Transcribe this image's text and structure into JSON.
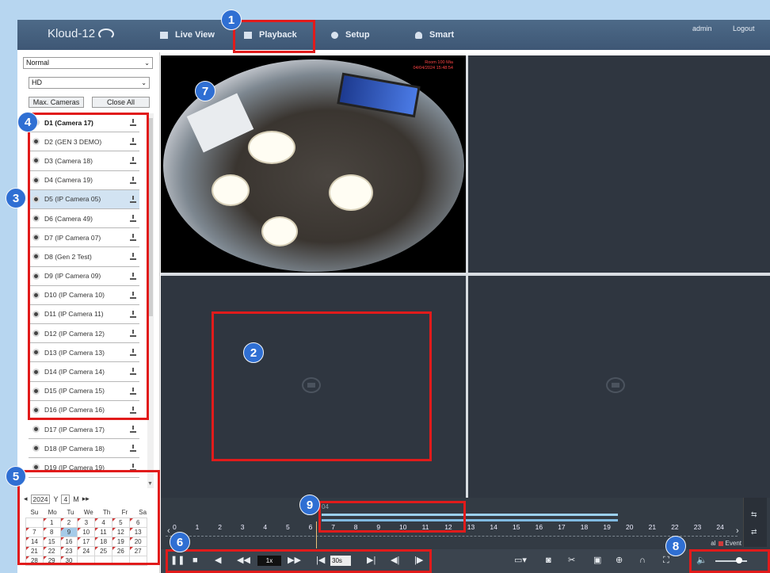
{
  "header": {
    "logo": "Kloud-12",
    "nav": [
      {
        "label": "Live View",
        "icon": "monitor-icon"
      },
      {
        "label": "Playback",
        "icon": "playback-icon"
      },
      {
        "label": "Setup",
        "icon": "gear-icon"
      },
      {
        "label": "Smart",
        "icon": "person-icon"
      }
    ],
    "user": "admin",
    "logout": "Logout"
  },
  "sidebar": {
    "mode_select": "Normal",
    "quality_select": "HD",
    "max_cameras": "Max. Cameras",
    "close_all": "Close All",
    "cameras": [
      "D1 (Camera 17)",
      "D2 (GEN 3 DEMO)",
      "D3 (Camera 18)",
      "D4 (Camera 19)",
      "D5 (IP Camera 05)",
      "D6 (Camera 49)",
      "D7 (IP Camera 07)",
      "D8 (Gen 2 Test)",
      "D9 (IP Camera 09)",
      "D10 (IP Camera 10)",
      "D11 (IP Camera 11)",
      "D12 (IP Camera 12)",
      "D13 (IP Camera 13)",
      "D14 (IP Camera 14)",
      "D15 (IP Camera 15)",
      "D16 (IP Camera 16)",
      "D17 (IP Camera 17)",
      "D18 (IP Camera 18)",
      "D19 (IP Camera 19)"
    ]
  },
  "calendar": {
    "year": "2024",
    "year_label": "Y",
    "month": "4",
    "month_label": "M",
    "weekdays": [
      "Su",
      "Mo",
      "Tu",
      "We",
      "Th",
      "Fr",
      "Sa"
    ],
    "weeks": [
      [
        "",
        "1",
        "2",
        "3",
        "4",
        "5",
        "6"
      ],
      [
        "7",
        "8",
        "9",
        "10",
        "11",
        "12",
        "13"
      ],
      [
        "14",
        "15",
        "16",
        "17",
        "18",
        "19",
        "20"
      ],
      [
        "21",
        "22",
        "23",
        "24",
        "25",
        "26",
        "27"
      ],
      [
        "28",
        "29",
        "30",
        "",
        "",
        "",
        ""
      ]
    ],
    "today": "9"
  },
  "video": {
    "osd_line1": "Room 100 Mia",
    "osd_line2": "04/04/2024 15:48:54"
  },
  "timeline": {
    "date_label": "04",
    "hours": [
      "0",
      "1",
      "2",
      "3",
      "4",
      "5",
      "6",
      "7",
      "8",
      "9",
      "10",
      "11",
      "12",
      "13",
      "14",
      "15",
      "16",
      "17",
      "18",
      "19",
      "20",
      "21",
      "22",
      "23",
      "24"
    ],
    "legend_event": "Event",
    "legend_normal": "al"
  },
  "controls": {
    "speed": "1x",
    "step": "30s"
  },
  "annotations": [
    "1",
    "2",
    "3",
    "4",
    "5",
    "6",
    "7",
    "8",
    "9"
  ],
  "colors": {
    "accent": "#2f6fd3",
    "highlight": "#e11b1b",
    "header": "#44607f"
  }
}
